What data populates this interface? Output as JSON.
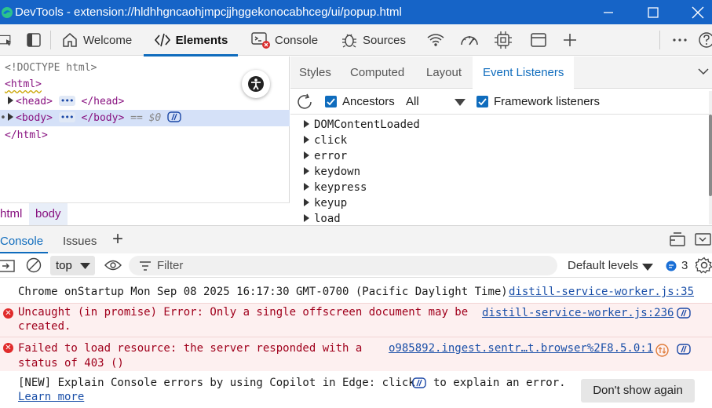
{
  "window": {
    "title": "DevTools - extension://hldhhgncaohjmpcjjhggekonocabhceg/ui/popup.html",
    "minimize_icon": "minimize-icon",
    "maximize_icon": "maximize-icon",
    "close_icon": "close-icon"
  },
  "main_tabs": {
    "welcome": "Welcome",
    "elements": "Elements",
    "console": "Console",
    "sources": "Sources"
  },
  "dom": {
    "doctype": "<!DOCTYPE html>",
    "html_open": "<html>",
    "head_open": "<head>",
    "head_close": "</head>",
    "body_open": "<body>",
    "body_close": "</body>",
    "body_ref": "== $0",
    "html_close": "</html>",
    "ellipsis": "•••"
  },
  "breadcrumbs": [
    "html",
    "body"
  ],
  "side_tabs": [
    "Styles",
    "Computed",
    "Layout",
    "Event Listeners"
  ],
  "event_options": {
    "ancestors_label": "Ancestors",
    "ancestors_checked": true,
    "filter_value": "All",
    "framework_label": "Framework listeners",
    "framework_checked": true
  },
  "event_listeners": [
    "DOMContentLoaded",
    "click",
    "error",
    "keydown",
    "keypress",
    "keyup",
    "load"
  ],
  "drawer_tabs": {
    "console": "Console",
    "issues": "Issues",
    "add": "+"
  },
  "console_toolbar": {
    "context": "top",
    "filter_placeholder": "Filter",
    "levels": "Default levels",
    "issues_count": "3"
  },
  "messages": [
    {
      "type": "log",
      "text": "Chrome onStartup Mon Sep 08 2025 16:17:30 GMT-0700 (Pacific Daylight Time)",
      "source": "distill-service-worker.js:35"
    },
    {
      "type": "error",
      "text_line1": "Uncaught (in promise) Error: Only a single offscreen document may be",
      "text_line2": "created.",
      "source": "distill-service-worker.js:236"
    },
    {
      "type": "error",
      "text_line1": "Failed to load resource: the server responded with a",
      "text_line2": "status of 403 ()",
      "source": "o985892.ingest.sentr…t.browser%2F8.5.0:1"
    }
  ],
  "copilot": {
    "text_before": "[NEW] Explain Console errors by using Copilot in Edge: click",
    "text_after": "to explain an error.",
    "learn_more": "Learn more",
    "dont_show": "Don't show again"
  },
  "colors": {
    "titlebar": "#1664c7",
    "accent": "#0f6cbd",
    "error_bg": "#fdf0f0",
    "error_text": "#a0001c",
    "tag": "#881280"
  }
}
